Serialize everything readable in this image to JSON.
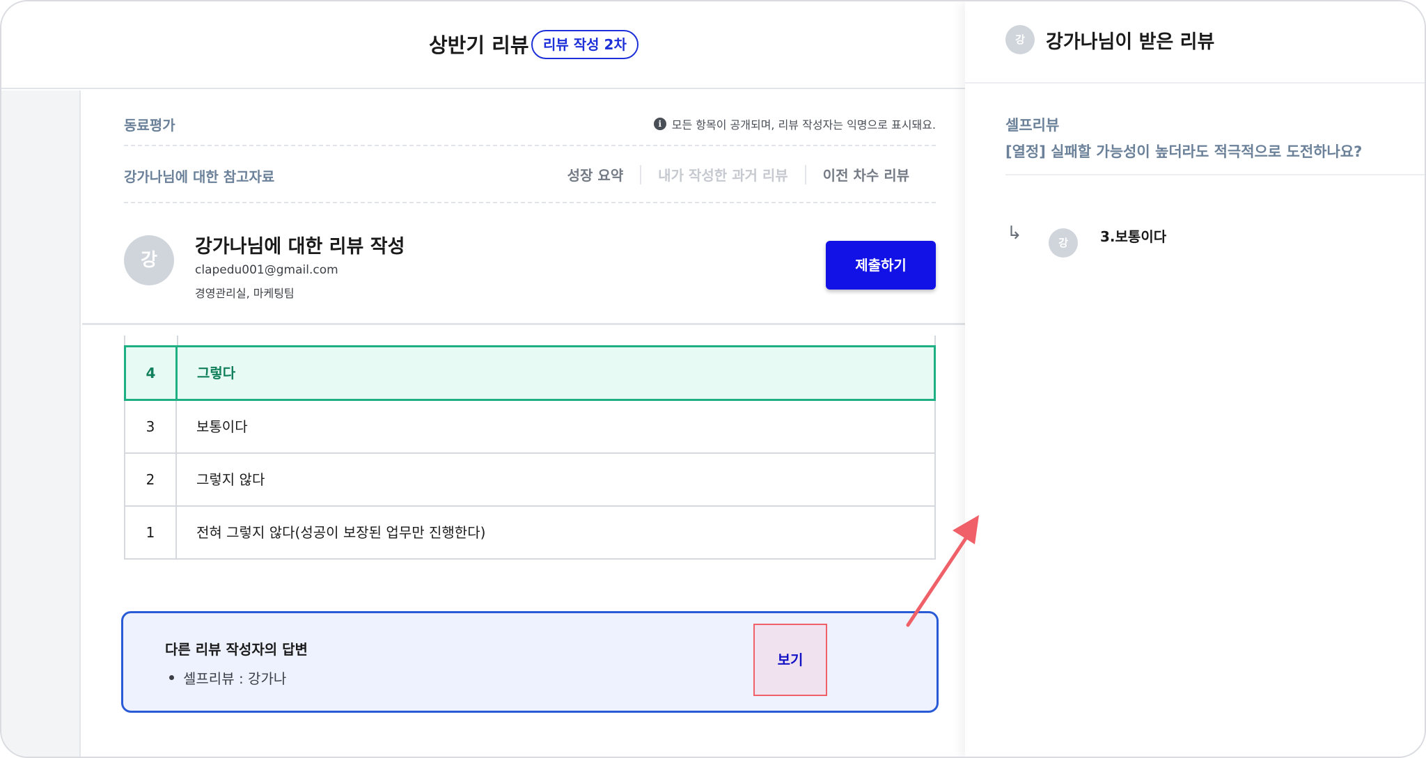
{
  "header": {
    "title": "상반기 리뷰",
    "badge": "리뷰 작성 2차"
  },
  "peer": {
    "label": "동료평가",
    "notice": "모든 항목이 공개되며, 리뷰 작성자는 익명으로 표시돼요.",
    "notice_icon": "i"
  },
  "reference": {
    "label": "강가나님에 대한 참고자료",
    "links": [
      "성장 요약",
      "내가 작성한 과거 리뷰",
      "이전 차수 리뷰"
    ]
  },
  "profile": {
    "avatar": "강",
    "title": "강가나님에 대한 리뷰 작성",
    "email": "clapedu001@gmail.com",
    "department": "경영관리실, 마케팅팀",
    "submit_label": "제출하기"
  },
  "options": [
    {
      "num": "4",
      "text": "그렇다",
      "selected": true
    },
    {
      "num": "3",
      "text": "보통이다",
      "selected": false
    },
    {
      "num": "2",
      "text": "그렇지 않다",
      "selected": false
    },
    {
      "num": "1",
      "text": "전혀 그렇지 않다(성공이 보장된 업무만 진행한다)",
      "selected": false
    }
  ],
  "others": {
    "title": "다른 리뷰 작성자의 답변",
    "item": "셀프리뷰 : 강가나",
    "view_label": "보기"
  },
  "panel": {
    "avatar": "강",
    "title": "강가나님이 받은 리뷰",
    "section": "셀프리뷰",
    "question": "[열정] 실패할 가능성이 높더라도 적극적으로 도전하나요?",
    "reply_icon": "↳",
    "reply_avatar": "강",
    "reply_text": "3.보통이다"
  },
  "colors": {
    "primary": "#1212e6",
    "selected_border": "#1eb082",
    "selected_bg": "#e7faf3",
    "others_border": "#2a5bd7",
    "annotation": "#f06068"
  }
}
